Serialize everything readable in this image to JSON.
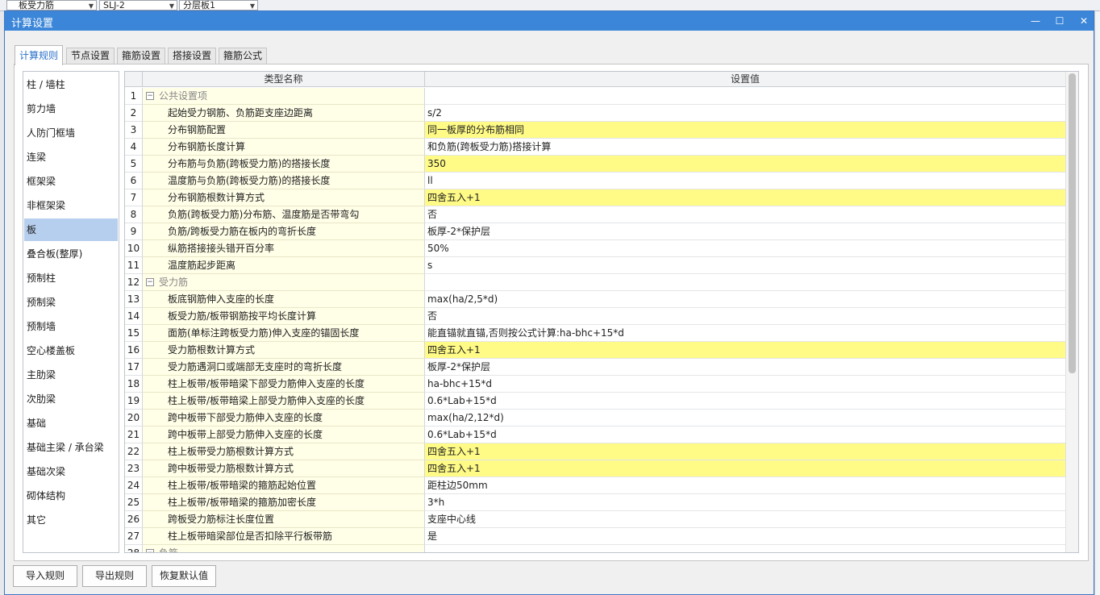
{
  "background": {
    "combos": [
      "板受力筋",
      "SLJ-2",
      "分层板1"
    ]
  },
  "dialog": {
    "title": "计算设置",
    "minimize": "—",
    "maximize": "☐",
    "close": "✕"
  },
  "tabs": [
    "计算规则",
    "节点设置",
    "箍筋设置",
    "搭接设置",
    "箍筋公式"
  ],
  "active_tab": "计算规则",
  "categories": [
    "柱 / 墙柱",
    "剪力墙",
    "人防门框墙",
    "连梁",
    "框架梁",
    "非框架梁",
    "板",
    "叠合板(整厚)",
    "预制柱",
    "预制梁",
    "预制墙",
    "空心楼盖板",
    "主肋梁",
    "次肋梁",
    "基础",
    "基础主梁 / 承台梁",
    "基础次梁",
    "砌体结构",
    "其它"
  ],
  "selected_category": "板",
  "grid": {
    "headers": [
      "",
      "类型名称",
      "设置值"
    ],
    "rows": [
      {
        "num": "1",
        "name": "公共设置项",
        "value": "",
        "group": true
      },
      {
        "num": "2",
        "name": "起始受力钢筋、负筋距支座边距离",
        "value": "s/2"
      },
      {
        "num": "3",
        "name": "分布钢筋配置",
        "value": "同一板厚的分布筋相同",
        "hl": true
      },
      {
        "num": "4",
        "name": "分布钢筋长度计算",
        "value": "和负筋(跨板受力筋)搭接计算"
      },
      {
        "num": "5",
        "name": "分布筋与负筋(跨板受力筋)的搭接长度",
        "value": "350",
        "hl": true
      },
      {
        "num": "6",
        "name": "温度筋与负筋(跨板受力筋)的搭接长度",
        "value": "ll"
      },
      {
        "num": "7",
        "name": "分布钢筋根数计算方式",
        "value": "四舍五入+1",
        "hl": true
      },
      {
        "num": "8",
        "name": "负筋(跨板受力筋)分布筋、温度筋是否带弯勾",
        "value": "否"
      },
      {
        "num": "9",
        "name": "负筋/跨板受力筋在板内的弯折长度",
        "value": "板厚-2*保护层"
      },
      {
        "num": "10",
        "name": "纵筋搭接接头错开百分率",
        "value": "50%"
      },
      {
        "num": "11",
        "name": "温度筋起步距离",
        "value": "s"
      },
      {
        "num": "12",
        "name": "受力筋",
        "value": "",
        "group": true
      },
      {
        "num": "13",
        "name": "板底钢筋伸入支座的长度",
        "value": "max(ha/2,5*d)"
      },
      {
        "num": "14",
        "name": "板受力筋/板带钢筋按平均长度计算",
        "value": "否"
      },
      {
        "num": "15",
        "name": "面筋(单标注跨板受力筋)伸入支座的锚固长度",
        "value": "能直锚就直锚,否则按公式计算:ha-bhc+15*d"
      },
      {
        "num": "16",
        "name": "受力筋根数计算方式",
        "value": "四舍五入+1",
        "hl": true
      },
      {
        "num": "17",
        "name": "受力筋遇洞口或端部无支座时的弯折长度",
        "value": "板厚-2*保护层"
      },
      {
        "num": "18",
        "name": "柱上板带/板带暗梁下部受力筋伸入支座的长度",
        "value": "ha-bhc+15*d"
      },
      {
        "num": "19",
        "name": "柱上板带/板带暗梁上部受力筋伸入支座的长度",
        "value": "0.6*Lab+15*d"
      },
      {
        "num": "20",
        "name": "跨中板带下部受力筋伸入支座的长度",
        "value": "max(ha/2,12*d)"
      },
      {
        "num": "21",
        "name": "跨中板带上部受力筋伸入支座的长度",
        "value": "0.6*Lab+15*d"
      },
      {
        "num": "22",
        "name": "柱上板带受力筋根数计算方式",
        "value": "四舍五入+1",
        "hl": true
      },
      {
        "num": "23",
        "name": "跨中板带受力筋根数计算方式",
        "value": "四舍五入+1",
        "hl": true
      },
      {
        "num": "24",
        "name": "柱上板带/板带暗梁的箍筋起始位置",
        "value": "距柱边50mm"
      },
      {
        "num": "25",
        "name": "柱上板带/板带暗梁的箍筋加密长度",
        "value": "3*h"
      },
      {
        "num": "26",
        "name": "跨板受力筋标注长度位置",
        "value": "支座中心线"
      },
      {
        "num": "27",
        "name": "柱上板带暗梁部位是否扣除平行板带筋",
        "value": "是"
      },
      {
        "num": "28",
        "name": "负筋",
        "value": "",
        "group": true
      }
    ]
  },
  "buttons": [
    "导入规则",
    "导出规则",
    "恢复默认值"
  ]
}
